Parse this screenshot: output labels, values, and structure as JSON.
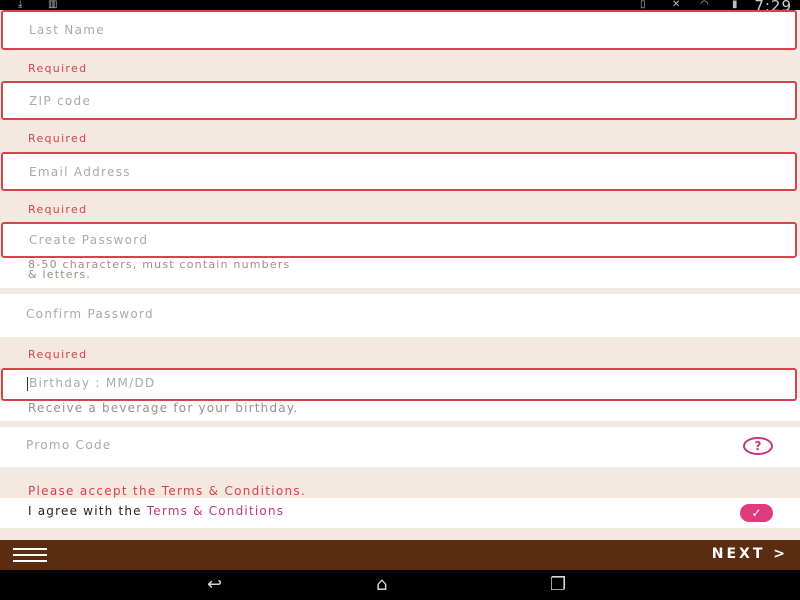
{
  "status_bar": {
    "time": "7:29"
  },
  "form": {
    "last_name": {
      "placeholder": "Last Name",
      "error": "Required"
    },
    "zip": {
      "placeholder": "ZIP code",
      "error": "Required"
    },
    "email": {
      "placeholder": "Email Address",
      "error": "Required"
    },
    "create_password": {
      "placeholder": "Create Password",
      "hint_line1": "8-50 characters, must contain numbers",
      "hint_line2": "& letters."
    },
    "confirm_password": {
      "placeholder": "Confirm Password",
      "error": "Required"
    },
    "birthday": {
      "placeholder": "Birthday : MM/DD",
      "hint": "Receive a beverage for your birthday."
    },
    "promo": {
      "placeholder": "Promo Code",
      "help_icon": "?"
    },
    "terms": {
      "error": "Please accept the Terms & Conditions.",
      "prefix": "I agree with the ",
      "link": "Terms & Conditions"
    }
  },
  "bottom_bar": {
    "next_label": "NEXT",
    "next_chevron": ">"
  },
  "icons": {
    "menu": "hamburger-icon",
    "help": "question-circle-icon",
    "check": "checkmark-icon",
    "back": "back-arrow-icon",
    "home": "home-icon",
    "recents": "recents-icon"
  },
  "colors": {
    "error": "#d8424b",
    "accent": "#c1377e",
    "bottom_bar": "#5b2d10",
    "background": "#f3e9e0"
  }
}
